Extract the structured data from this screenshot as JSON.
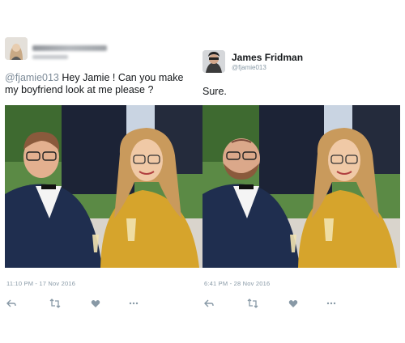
{
  "left_tweet": {
    "handle": "@fjamie013",
    "text_suffix": " Hey Jamie ! Can you make my boyfriend look at me please ?",
    "timestamp": "11:10 PM - 17 Nov 2016"
  },
  "right_tweet": {
    "name": "James Fridman",
    "handle": "@fjamie013",
    "text": "Sure.",
    "timestamp": "6:41 PM - 28 Nov 2016"
  },
  "icons": [
    "reply-icon",
    "retweet-icon",
    "like-icon",
    "more-icon"
  ],
  "colors": {
    "muted_text": "#8899a6",
    "grass": "#4d7a3a",
    "suit_navy": "#1f2e4f",
    "dress_yellow": "#d6a42c"
  }
}
